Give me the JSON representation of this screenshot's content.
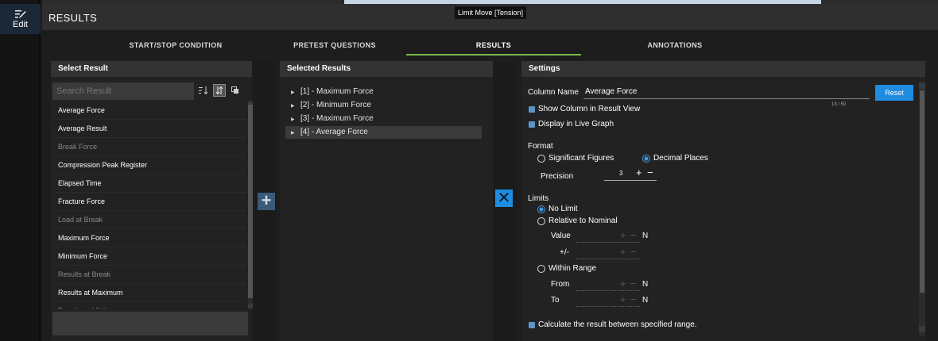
{
  "sidebar": {
    "edit_label": "Edit"
  },
  "header": {
    "title": "RESULTS",
    "tooltip": "Limit Move [Tension]"
  },
  "tabs": [
    {
      "label": "START/STOP CONDITION",
      "active": false
    },
    {
      "label": "PRETEST QUESTIONS",
      "active": false
    },
    {
      "label": "RESULTS",
      "active": true
    },
    {
      "label": "ANNOTATIONS",
      "active": false
    }
  ],
  "select_result": {
    "title": "Select Result",
    "search_placeholder": "Search Result",
    "items": [
      {
        "label": "Average Force",
        "enabled": true
      },
      {
        "label": "Average Result",
        "enabled": true
      },
      {
        "label": "Break Force",
        "enabled": false
      },
      {
        "label": "Compression Peak Register",
        "enabled": true
      },
      {
        "label": "Elapsed Time",
        "enabled": true
      },
      {
        "label": "Fracture Force",
        "enabled": true
      },
      {
        "label": "Load at Break",
        "enabled": false
      },
      {
        "label": "Maximum Force",
        "enabled": true
      },
      {
        "label": "Minimum Force",
        "enabled": true
      },
      {
        "label": "Results at Break",
        "enabled": false
      },
      {
        "label": "Results at Maximum",
        "enabled": true
      },
      {
        "label": "Results at Minimum",
        "enabled": true
      }
    ]
  },
  "selected_results": {
    "title": "Selected Results",
    "items": [
      {
        "label": "[1] - Maximum Force"
      },
      {
        "label": "[2] - Minimum Force"
      },
      {
        "label": "[3] - Maximum Force"
      },
      {
        "label": "[4] - Average Force"
      }
    ]
  },
  "settings": {
    "title": "Settings",
    "column_name_label": "Column Name",
    "column_name_value": "Average Force",
    "char_counter": "13 / 50",
    "reset_label": "Reset",
    "show_in_result_view": "Show Column in Result View",
    "display_in_live_graph": "Display in Live Graph",
    "format_label": "Format",
    "significant_figures": "Significant Figures",
    "decimal_places": "Decimal Places",
    "precision_label": "Precision",
    "precision_value": "3",
    "limits_label": "Limits",
    "no_limit": "No Limit",
    "relative_to_nominal": "Relative to Nominal",
    "value_label": "Value",
    "plus_minus_label": "+/-",
    "within_range": "Within Range",
    "from_label": "From",
    "to_label": "To",
    "unit": "N",
    "calculate_between": "Calculate the result between specified range."
  },
  "colors": {
    "accent_blue": "#1e8ce0",
    "active_tab": "#7ab84a"
  }
}
